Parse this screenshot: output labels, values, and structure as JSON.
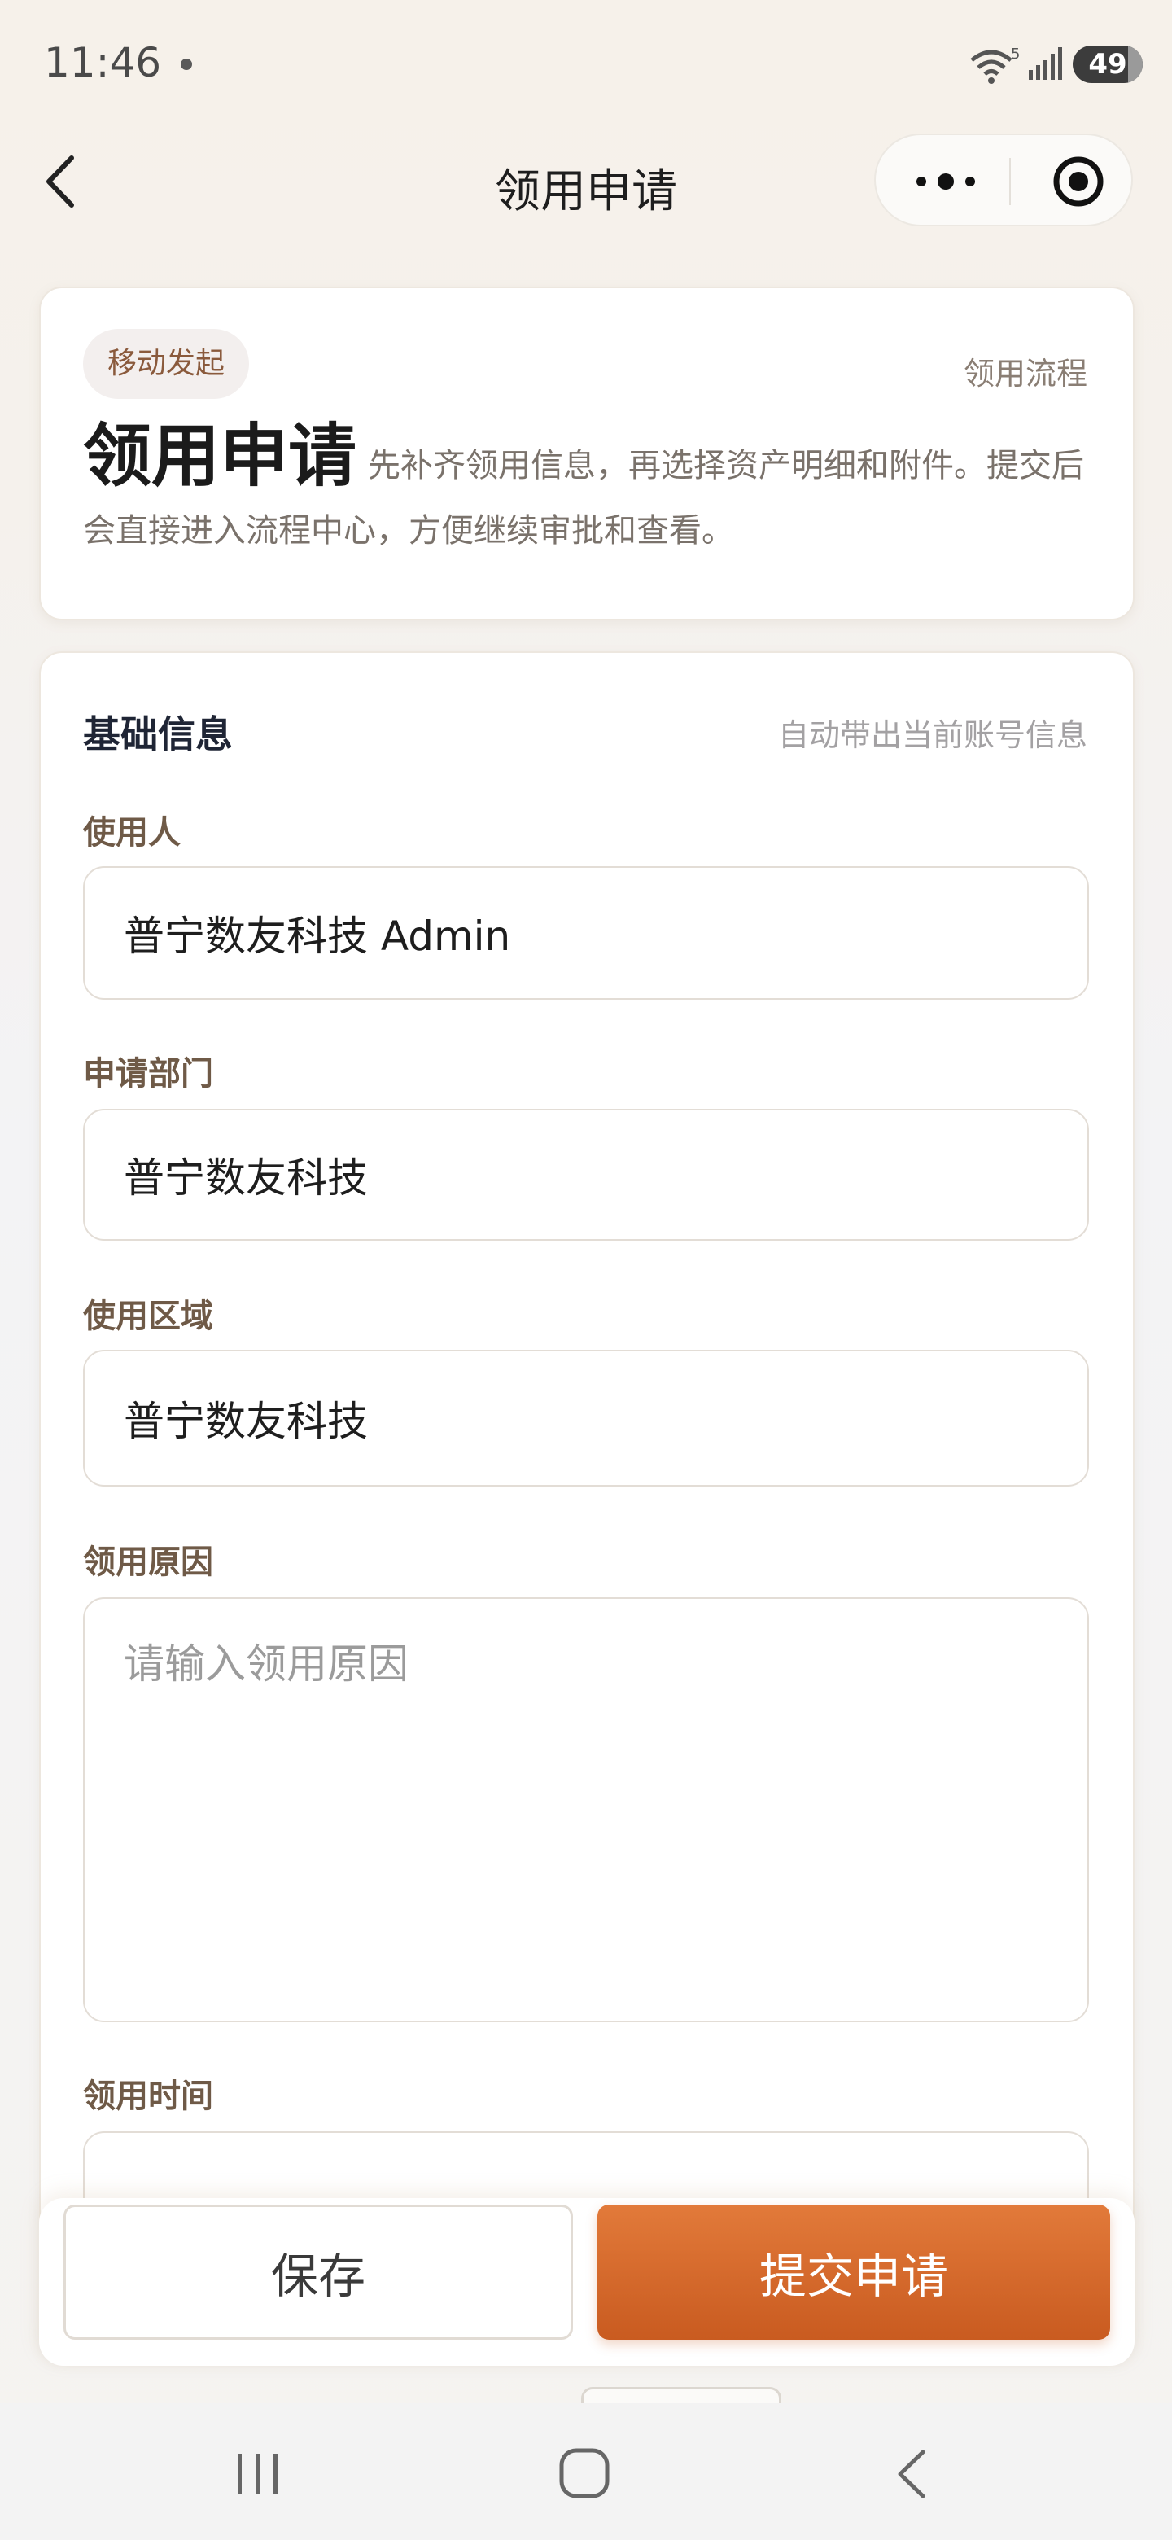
{
  "status_bar": {
    "time": "11:46",
    "wifi_badge": "5",
    "battery": "49"
  },
  "nav": {
    "title": "领用申请",
    "back_icon": "chevron-left-icon",
    "more_icon": "more-dots-icon",
    "target_icon": "target-icon"
  },
  "hero": {
    "tag": "移动发起",
    "flow_link": "领用流程",
    "title": "领用申请",
    "description": "先补齐领用信息，再选择资产明细和附件。提交后会直接进入流程中心，方便继续审批和查看。"
  },
  "form": {
    "section_title": "基础信息",
    "section_hint": "自动带出当前账号信息",
    "user_label": "使用人",
    "user_value": "普宁数友科技 Admin",
    "dept_label": "申请部门",
    "dept_value": "普宁数友科技",
    "area_label": "使用区域",
    "area_value": "普宁数友科技",
    "reason_label": "领用原因",
    "reason_placeholder": "请输入领用原因",
    "time_label": "领用时间"
  },
  "actions": {
    "save": "保存",
    "submit": "提交申请"
  },
  "colors": {
    "accent": "#d9692b",
    "label": "#6f5a47",
    "background": "#f6f1ea"
  }
}
